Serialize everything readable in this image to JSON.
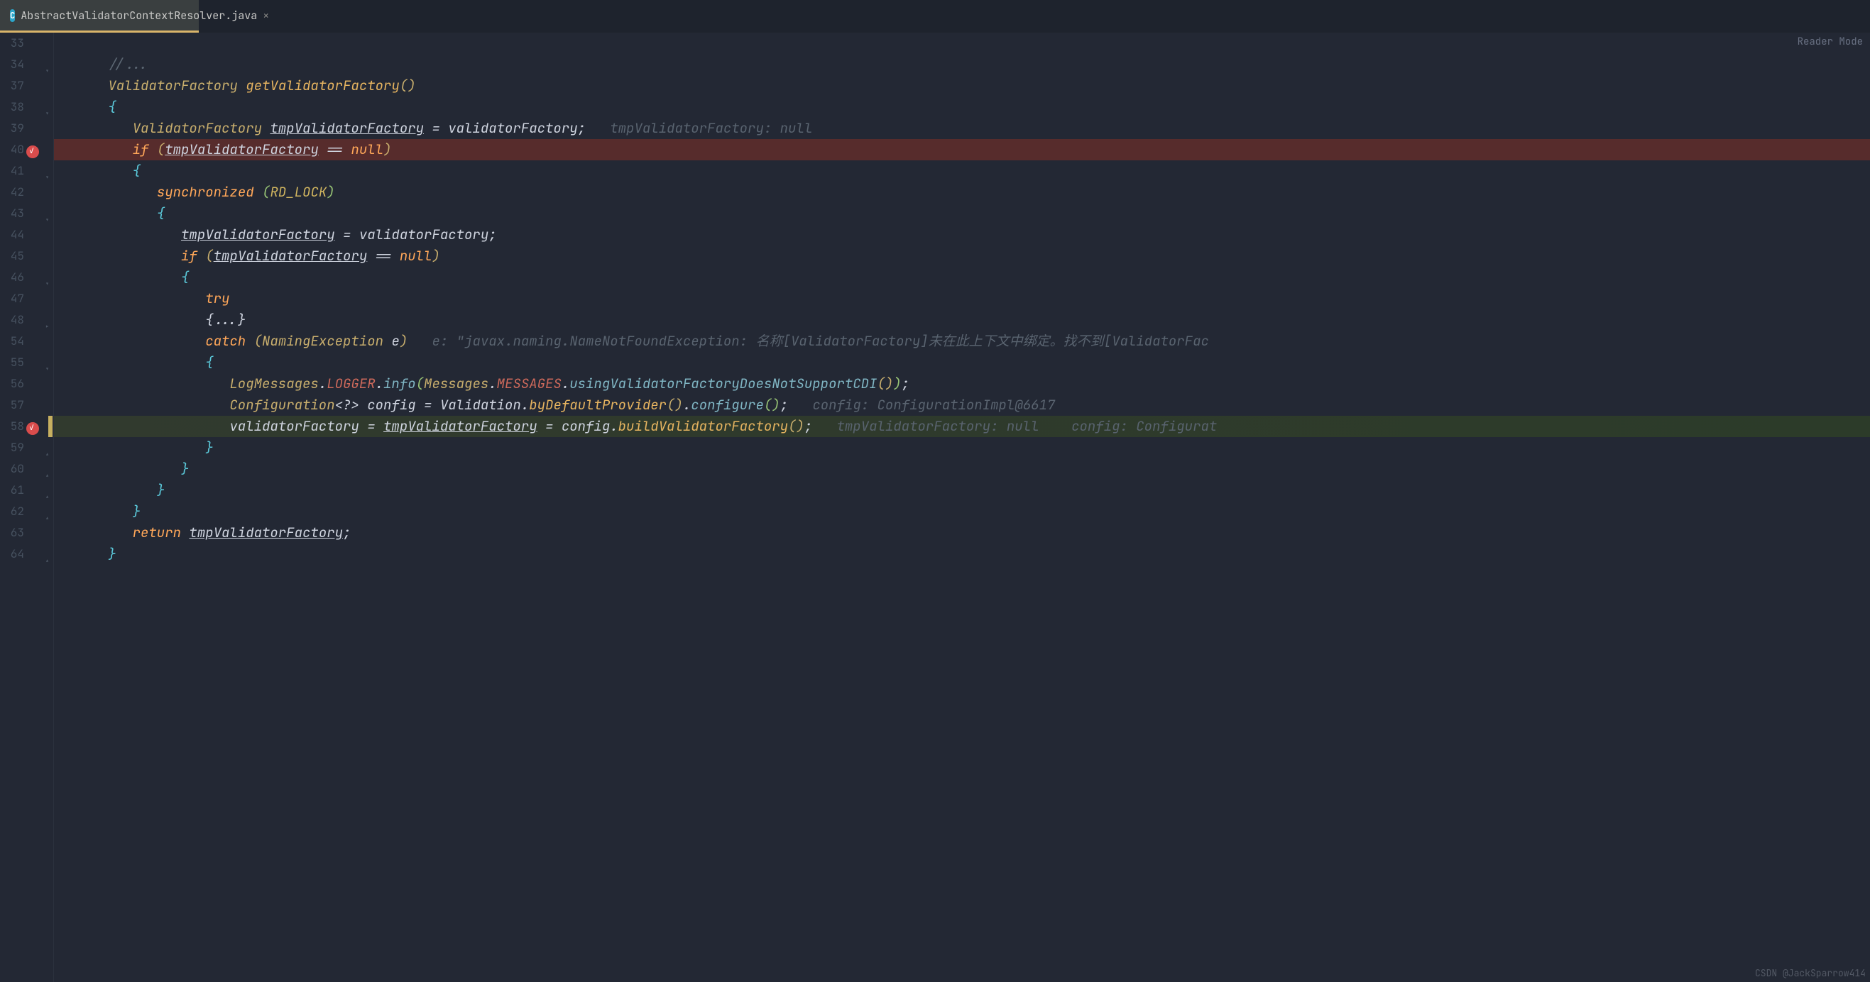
{
  "tab": {
    "filename": "AbstractValidatorContextResolver.java",
    "icon_letter": "C"
  },
  "reader_mode": "Reader Mode",
  "watermark": "CSDN @JackSparrow414",
  "line_numbers": [
    "33",
    "34",
    "37",
    "38",
    "39",
    "40",
    "41",
    "42",
    "43",
    "44",
    "45",
    "46",
    "47",
    "48",
    "54",
    "55",
    "56",
    "57",
    "58",
    "59",
    "60",
    "61",
    "62",
    "63",
    "64"
  ],
  "breakpoints": {
    "40": true,
    "58": true
  },
  "fold_markers": {
    "34": "▾",
    "38": "▾",
    "40": "",
    "41": "▾",
    "43": "▾",
    "45": "",
    "46": "▾",
    "48": "▸",
    "54": "",
    "55": "▾",
    "59": "▴",
    "60": "▴",
    "61": "▴",
    "62": "▴",
    "64": "▴"
  },
  "code": {
    "34": {
      "indent": 2,
      "comment": "//..."
    },
    "37": {
      "indent": 2,
      "type": "ValidatorFactory",
      "method": "getValidatorFactory",
      "parens": "()"
    },
    "38": {
      "indent": 2,
      "brace": "{"
    },
    "39": {
      "indent": 3,
      "type": "ValidatorFactory",
      "var_u": "tmpValidatorFactory",
      "assign": " = ",
      "rhs": "validatorFactory",
      "semi": ";",
      "inlay": "   tmpValidatorFactory: null"
    },
    "40": {
      "indent": 3,
      "kw": "if",
      "open": " (",
      "var_u": "tmpValidatorFactory",
      "op": " == ",
      "null": "null",
      "close": ")"
    },
    "41": {
      "indent": 3,
      "brace": "{"
    },
    "42": {
      "indent": 4,
      "kw": "synchronized",
      "open_g": " (",
      "const": "RD_LOCK",
      "close_g": ")"
    },
    "43": {
      "indent": 4,
      "brace": "{"
    },
    "44": {
      "indent": 5,
      "var_u": "tmpValidatorFactory",
      "assign": " = ",
      "rhs": "validatorFactory",
      "semi": ";"
    },
    "45": {
      "indent": 5,
      "kw": "if",
      "open": " (",
      "var_u": "tmpValidatorFactory",
      "op": " == ",
      "null": "null",
      "close": ")"
    },
    "46": {
      "indent": 5,
      "brace": "{"
    },
    "47": {
      "indent": 6,
      "kw": "try"
    },
    "48": {
      "indent": 6,
      "folded": "{...}"
    },
    "54": {
      "indent": 6,
      "kw": "catch",
      "open": " (",
      "ex_type": "NamingException",
      "ex_var": " e",
      "close": ")",
      "inlay": "   e: \"javax.naming.NameNotFoundException: 名称[ValidatorFactory]未在此上下文中绑定。找不到[ValidatorFac"
    },
    "55": {
      "indent": 6,
      "brace": "{"
    },
    "56": {
      "indent": 7,
      "seg": [
        {
          "t": "LogMessages",
          "c": "c-type"
        },
        {
          "t": ".",
          "c": "c-white"
        },
        {
          "t": "LOGGER",
          "c": "c-red"
        },
        {
          "t": ".",
          "c": "c-white"
        },
        {
          "t": "info",
          "c": "c-call"
        },
        {
          "t": "(",
          "c": "c-green"
        },
        {
          "t": "Messages",
          "c": "c-type"
        },
        {
          "t": ".",
          "c": "c-white"
        },
        {
          "t": "MESSAGES",
          "c": "c-red"
        },
        {
          "t": ".",
          "c": "c-white"
        },
        {
          "t": "usingValidatorFactoryDoesNotSupportCDI",
          "c": "c-call"
        },
        {
          "t": "()",
          "c": "c-type"
        },
        {
          "t": ")",
          "c": "c-green"
        },
        {
          "t": ";",
          "c": "c-white"
        }
      ]
    },
    "57": {
      "indent": 7,
      "seg": [
        {
          "t": "Configuration",
          "c": "c-type"
        },
        {
          "t": "<",
          "c": "c-white"
        },
        {
          "t": "?",
          "c": "c-white"
        },
        {
          "t": ">",
          "c": "c-white"
        },
        {
          "t": " config",
          "c": "c-var"
        },
        {
          "t": " = ",
          "c": "c-white"
        },
        {
          "t": "Validation",
          "c": "c-white"
        },
        {
          "t": ".",
          "c": "c-white"
        },
        {
          "t": "byDefaultProvider",
          "c": "c-call2"
        },
        {
          "t": "()",
          "c": "c-type"
        },
        {
          "t": ".",
          "c": "c-white"
        },
        {
          "t": "configure",
          "c": "c-call"
        },
        {
          "t": "()",
          "c": "c-green"
        },
        {
          "t": ";",
          "c": "c-white"
        }
      ],
      "inlay": "   config: ConfigurationImpl@6617"
    },
    "58": {
      "indent": 7,
      "seg": [
        {
          "t": "validatorFactory",
          "c": "c-white"
        },
        {
          "t": " = ",
          "c": "c-white"
        },
        {
          "t": "tmpValidatorFactory",
          "c": "c-var-u"
        },
        {
          "t": " = ",
          "c": "c-white"
        },
        {
          "t": "config",
          "c": "c-white"
        },
        {
          "t": ".",
          "c": "c-white"
        },
        {
          "t": "buildValidatorFactory",
          "c": "c-call2"
        },
        {
          "t": "()",
          "c": "c-type"
        },
        {
          "t": ";",
          "c": "c-white"
        }
      ],
      "inlay": "   tmpValidatorFactory: null    config: Configurat"
    },
    "59": {
      "indent": 6,
      "brace": "}"
    },
    "60": {
      "indent": 5,
      "brace": "}"
    },
    "61": {
      "indent": 4,
      "brace": "}"
    },
    "62": {
      "indent": 3,
      "brace": "}"
    },
    "63": {
      "indent": 3,
      "kw": "return",
      "space": " ",
      "var_u": "tmpValidatorFactory",
      "semi": ";"
    },
    "64": {
      "indent": 2,
      "brace_close": "}"
    }
  }
}
